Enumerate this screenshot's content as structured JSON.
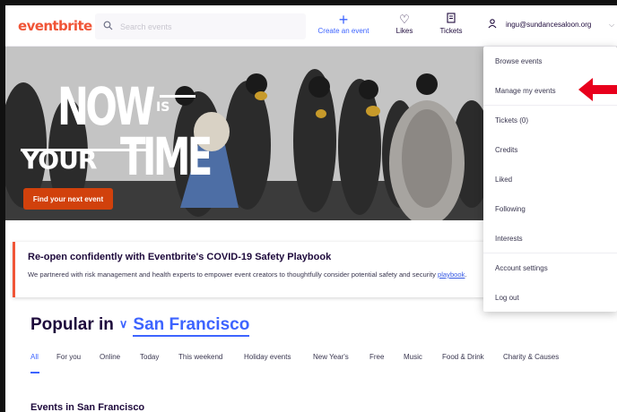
{
  "header": {
    "logo": "eventbrite",
    "search_placeholder": "Search events",
    "create_label": "Create an event",
    "likes_label": "Likes",
    "tickets_label": "Tickets",
    "user_email": "ingu@sundancesaloon.org"
  },
  "hero": {
    "line_now": "NOW",
    "line_is": "IS",
    "line_your": "YOUR",
    "line_time": "TIME",
    "cta_label": "Find your next event"
  },
  "covid": {
    "title": "Re-open confidently with Eventbrite's COVID-19 Safety Playbook",
    "body": "We partnered with risk management and health experts to empower event creators to thoughtfully consider potential safety and security",
    "link": "playbook"
  },
  "popular": {
    "prefix": "Popular in",
    "city": "San Francisco"
  },
  "tabs": [
    "All",
    "For you",
    "Online",
    "Today",
    "This weekend",
    "Holiday events",
    "New Year's",
    "Free",
    "Music",
    "Food & Drink",
    "Charity & Causes"
  ],
  "events_heading": "Events in San Francisco",
  "dropdown": {
    "items": [
      "Browse events",
      "Manage my events",
      "Tickets (0)",
      "Credits",
      "Liked",
      "Following",
      "Interests",
      "Account settings",
      "Log out"
    ]
  },
  "colors": {
    "brand": "#f05537",
    "accent": "#3d64ff",
    "arrow": "#e8001c"
  }
}
